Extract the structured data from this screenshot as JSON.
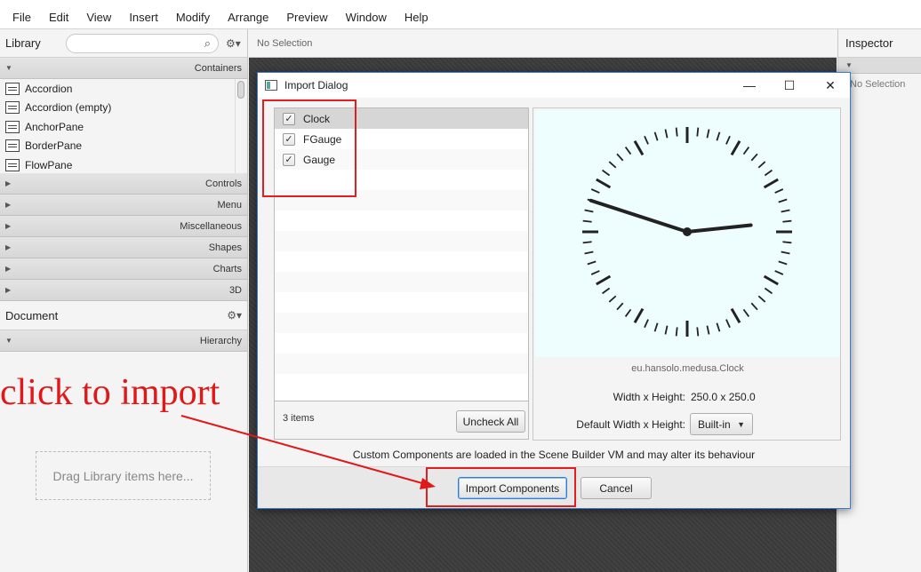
{
  "menu": [
    "File",
    "Edit",
    "View",
    "Insert",
    "Modify",
    "Arrange",
    "Preview",
    "Window",
    "Help"
  ],
  "library": {
    "title": "Library",
    "search_icon": "search-icon",
    "gear_icon": "gear-icon",
    "open_section": "Containers",
    "items": [
      "Accordion",
      "Accordion  (empty)",
      "AnchorPane",
      "BorderPane",
      "FlowPane"
    ],
    "sections": [
      "Controls",
      "Menu",
      "Miscellaneous",
      "Shapes",
      "Charts",
      "3D"
    ]
  },
  "document": {
    "title": "Document",
    "section": "Hierarchy",
    "drag_hint": "Drag Library items here..."
  },
  "center": {
    "selection": "No Selection"
  },
  "inspector": {
    "title": "Inspector",
    "no_selection": "No Selection"
  },
  "dialog": {
    "title": "Import Dialog",
    "components": [
      {
        "name": "Clock",
        "checked": true,
        "selected": true
      },
      {
        "name": "FGauge",
        "checked": true,
        "selected": false
      },
      {
        "name": "Gauge",
        "checked": true,
        "selected": false
      }
    ],
    "item_count": "3 items",
    "uncheck_all": "Uncheck All",
    "class_name": "eu.hansolo.medusa.Clock",
    "size_label": "Width x Height:",
    "size_value": "250.0 x 250.0",
    "default_size_label": "Default Width x Height:",
    "default_size_value": "Built-in",
    "notice": "Custom Components are loaded in the Scene Builder VM and may alter its behaviour",
    "import_button": "Import Components",
    "cancel_button": "Cancel",
    "clock_preview": {
      "hour": 2,
      "minute": 48
    }
  },
  "annotation": {
    "text": "click to import",
    "color": "#e01818"
  }
}
